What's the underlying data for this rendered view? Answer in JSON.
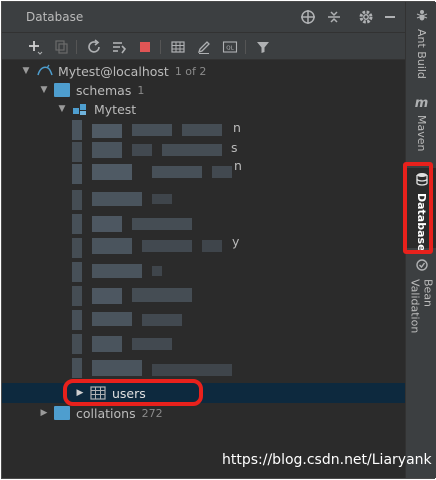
{
  "panel": {
    "title": "Database"
  },
  "tree": {
    "connection": {
      "label": "Mytest@localhost",
      "count": "1 of 2"
    },
    "schemas": {
      "label": "schemas",
      "count": "1"
    },
    "schema": {
      "label": "Mytest"
    },
    "partial_items": [
      {
        "suffix": "n"
      },
      {
        "suffix": "s"
      },
      {
        "suffix": "n"
      },
      {
        "suffix": "y"
      }
    ],
    "users": {
      "label": "users"
    },
    "collations": {
      "label": "collations",
      "count": "272"
    }
  },
  "side_tabs": [
    {
      "label": "Ant Build",
      "icon": "ant-icon"
    },
    {
      "label": "Maven",
      "icon": "maven-icon",
      "glyph": "m"
    },
    {
      "label": "Database",
      "icon": "database-icon"
    },
    {
      "label": "Bean Validation",
      "icon": "bean-validation-icon"
    }
  ],
  "watermark": "https://blog.csdn.net/Liaryank",
  "colors": {
    "background": "#2b2b2b",
    "toolbar": "#3c3f41",
    "selection": "#0d293e",
    "folder": "#4e9ecf",
    "stop": "#e05555",
    "highlight": "#e8211c"
  }
}
